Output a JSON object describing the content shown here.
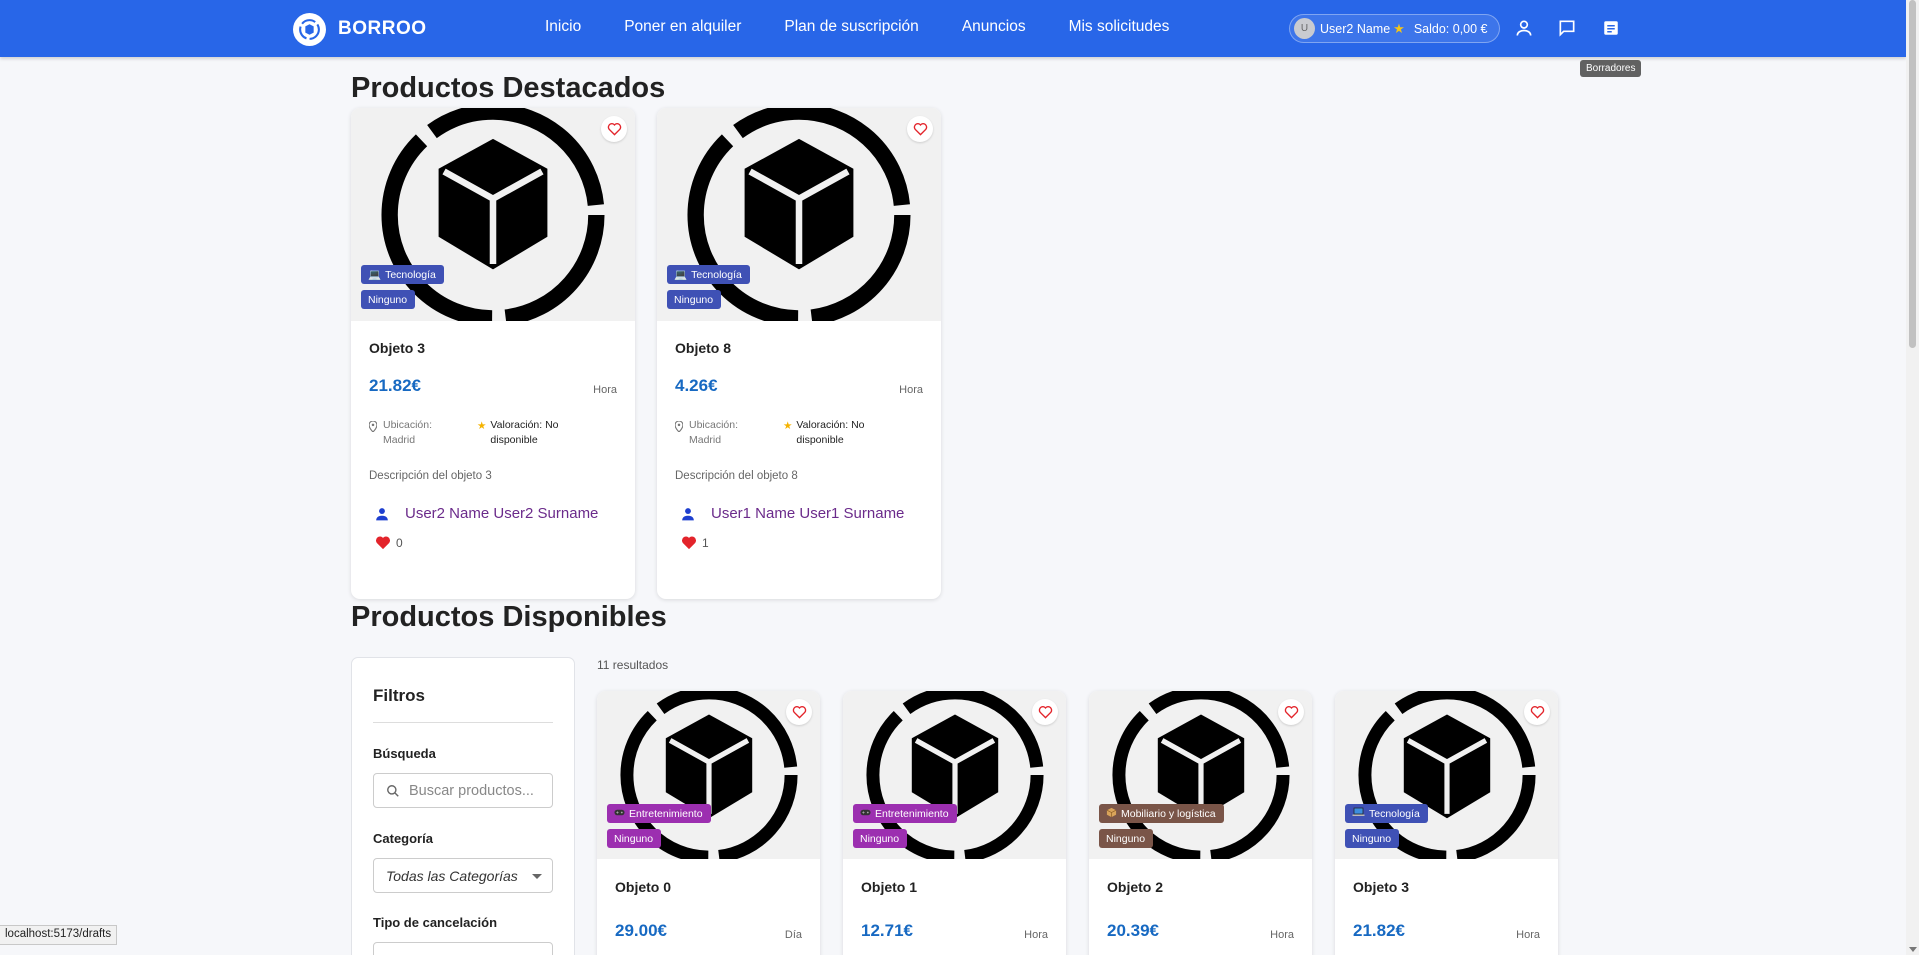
{
  "header": {
    "brand": "BORROO",
    "nav": [
      "Inicio",
      "Poner en alquiler",
      "Plan de suscripción",
      "Anuncios",
      "Mis solicitudes"
    ],
    "user": {
      "avatar_letter": "U",
      "name": "User2 Name",
      "balance": "Saldo: 0,00 €"
    },
    "tooltip": "Borradores",
    "colors": {
      "primary": "#2866e8"
    }
  },
  "featured": {
    "title": "Productos Destacados",
    "items": [
      {
        "name": "Objeto 3",
        "price": "21.82€",
        "unit": "Hora",
        "category": "Tecnología",
        "cancellation": "Ninguno",
        "location_label": "Ubicación:",
        "location": "Madrid",
        "rating": "Valoración: No disponible",
        "description": "Descripción del objeto 3",
        "owner": "User2 Name User2 Surname",
        "likes": "0"
      },
      {
        "name": "Objeto 8",
        "price": "4.26€",
        "unit": "Hora",
        "category": "Tecnología",
        "cancellation": "Ninguno",
        "location_label": "Ubicación:",
        "location": "Madrid",
        "rating": "Valoración: No disponible",
        "description": "Descripción del objeto 8",
        "owner": "User1 Name User1 Surname",
        "likes": "1"
      }
    ]
  },
  "available": {
    "title": "Productos Disponibles",
    "results": "11 resultados",
    "filters": {
      "title": "Filtros",
      "search_label": "Búsqueda",
      "search_placeholder": "Buscar productos...",
      "category_label": "Categoría",
      "category_value": "Todas las Categorías",
      "cancellation_label": "Tipo de cancelación"
    },
    "items": [
      {
        "name": "Objeto 0",
        "price": "29.00€",
        "unit": "Día",
        "category": "Entretenimiento",
        "cat_color": "#9c2fb0",
        "cat_icon": "gamepad",
        "cancellation": "Ninguno"
      },
      {
        "name": "Objeto 1",
        "price": "12.71€",
        "unit": "Hora",
        "category": "Entretenimiento",
        "cat_color": "#9c2fb0",
        "cat_icon": "gamepad",
        "cancellation": "Ninguno"
      },
      {
        "name": "Objeto 2",
        "price": "20.39€",
        "unit": "Hora",
        "category": "Mobiliario y logística",
        "cat_color": "#7a5548",
        "cat_icon": "box",
        "cancellation": "Ninguno"
      },
      {
        "name": "Objeto 3",
        "price": "21.82€",
        "unit": "Hora",
        "category": "Tecnología",
        "cat_color": "#3f51b5",
        "cat_icon": "laptop",
        "cancellation": "Ninguno"
      }
    ]
  },
  "statusbar": "localhost:5173/drafts"
}
